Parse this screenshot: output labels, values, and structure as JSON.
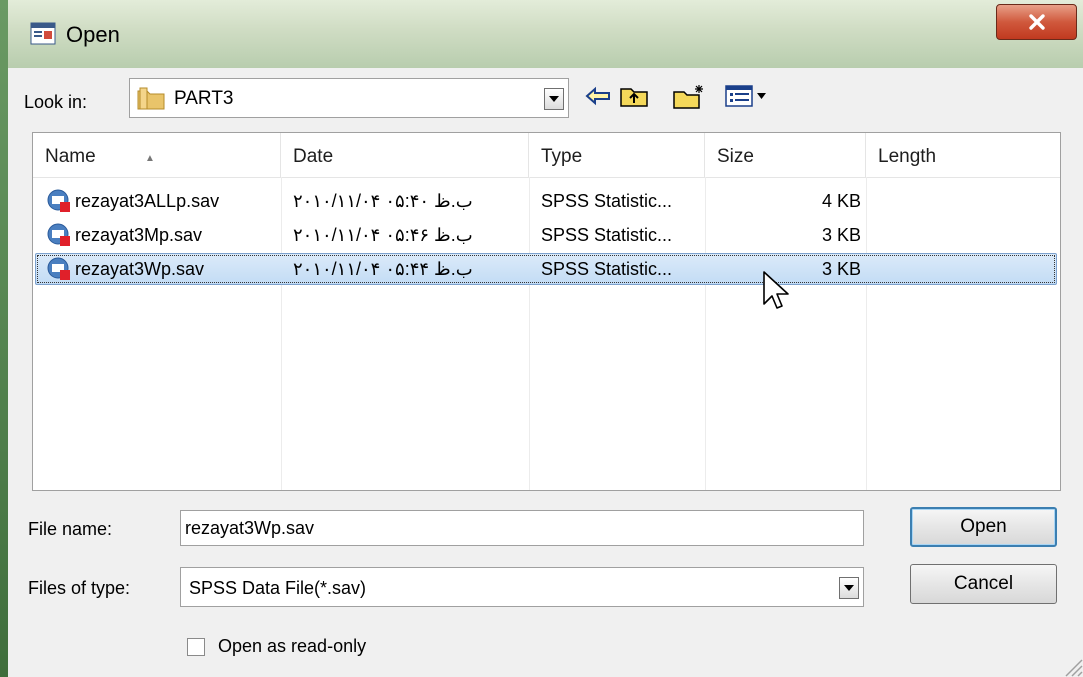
{
  "window": {
    "title": "Open"
  },
  "lookin": {
    "label": "Look in:",
    "value": "PART3"
  },
  "columns": [
    "Name",
    "Date",
    "Type",
    "Size",
    "Length"
  ],
  "files": [
    {
      "name": "rezayat3ALLp.sav",
      "date": "۲۰۱۰/۱۱/۰۴ ب.ظ ۰۵:۴۰",
      "type": "SPSS Statistic...",
      "size": "4 KB",
      "length": "",
      "selected": false
    },
    {
      "name": "rezayat3Mp.sav",
      "date": "۲۰۱۰/۱۱/۰۴ ب.ظ ۰۵:۴۶",
      "type": "SPSS Statistic...",
      "size": "3 KB",
      "length": "",
      "selected": false
    },
    {
      "name": "rezayat3Wp.sav",
      "date": "۲۰۱۰/۱۱/۰۴ ب.ظ ۰۵:۴۴",
      "type": "SPSS Statistic...",
      "size": "3 KB",
      "length": "",
      "selected": true
    }
  ],
  "form": {
    "filename_label": "File name:",
    "filename_value": "rezayat3Wp.sav",
    "filetype_label": "Files of type:",
    "filetype_value": "SPSS Data File(*.sav)",
    "readonly_label": "Open as read-only",
    "readonly_checked": false
  },
  "buttons": {
    "open": "Open",
    "cancel": "Cancel",
    "close": "X"
  },
  "icons": {
    "app": "spss-app-icon",
    "lookin_folder": "folder-icon",
    "toolbar": [
      "back-arrow-icon",
      "up-folder-icon",
      "new-folder-icon",
      "view-menu-icon"
    ],
    "file": "spss-file-icon"
  },
  "colors": {
    "selection_bg": "#c3dcf5",
    "selection_border": "#7da2ce",
    "close_button": "#c0391f",
    "titlebar": "#cfdcc3"
  }
}
